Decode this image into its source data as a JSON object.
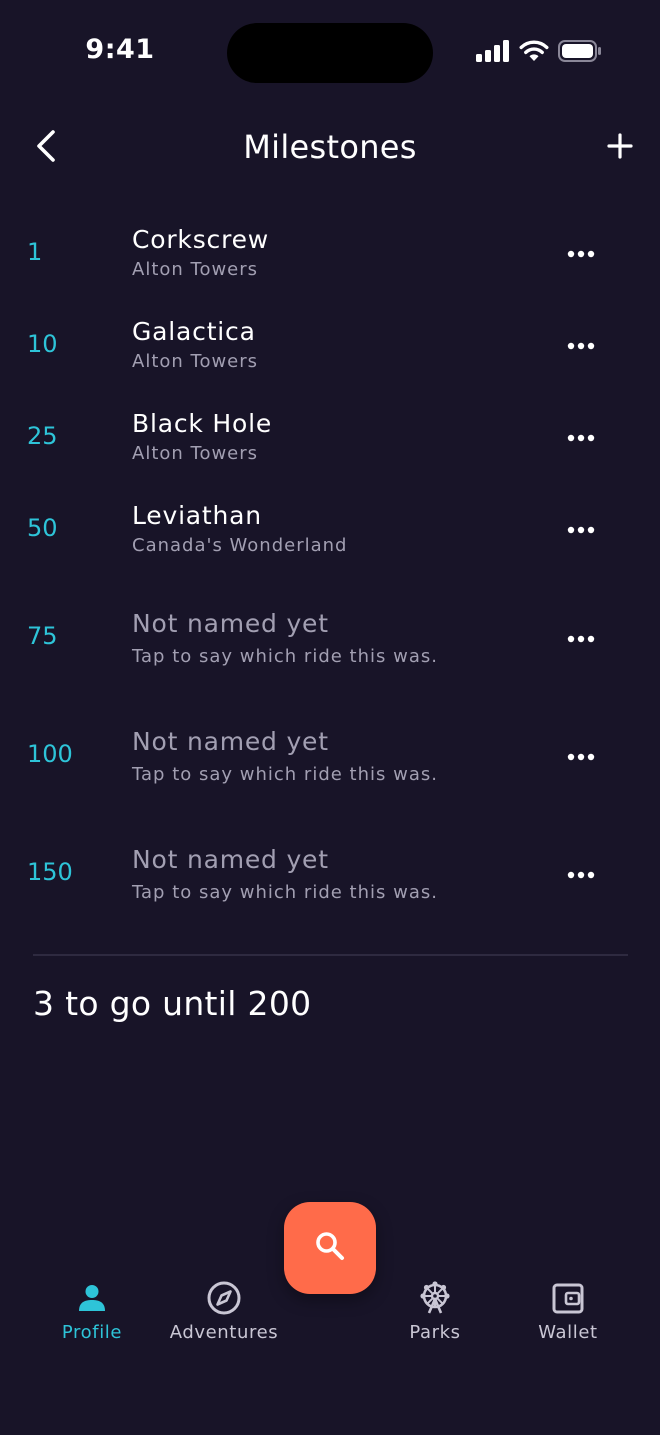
{
  "status_bar": {
    "time": "9:41"
  },
  "header": {
    "title": "Milestones",
    "back_icon": "chevron-left-icon",
    "add_icon": "plus-icon"
  },
  "milestones": [
    {
      "number": "1",
      "title": "Corkscrew",
      "subtitle": "Alton Towers",
      "named": true
    },
    {
      "number": "10",
      "title": "Galactica",
      "subtitle": "Alton Towers",
      "named": true
    },
    {
      "number": "25",
      "title": "Black Hole",
      "subtitle": "Alton Towers",
      "named": true
    },
    {
      "number": "50",
      "title": "Leviathan",
      "subtitle": "Canada's Wonderland",
      "named": true
    },
    {
      "number": "75",
      "title": "Not named yet",
      "subtitle": "Tap to say which ride this was.",
      "named": false
    },
    {
      "number": "100",
      "title": "Not named yet",
      "subtitle": "Tap to say which ride this was.",
      "named": false
    },
    {
      "number": "150",
      "title": "Not named yet",
      "subtitle": "Tap to say which ride this was.",
      "named": false
    }
  ],
  "summary": {
    "text": "3 to go until 200"
  },
  "tab_bar": {
    "tabs": [
      {
        "label": "Profile",
        "icon": "person-icon",
        "active": true
      },
      {
        "label": "Adventures",
        "icon": "compass-icon",
        "active": false
      },
      {
        "label": "Parks",
        "icon": "ferris-wheel-icon",
        "active": false
      },
      {
        "label": "Wallet",
        "icon": "wallet-icon",
        "active": false
      }
    ],
    "fab_icon": "search-icon"
  },
  "colors": {
    "background": "#181428",
    "accent": "#2ec4d8",
    "fab": "#ff6b4a",
    "muted_text": "#a29fb2"
  }
}
